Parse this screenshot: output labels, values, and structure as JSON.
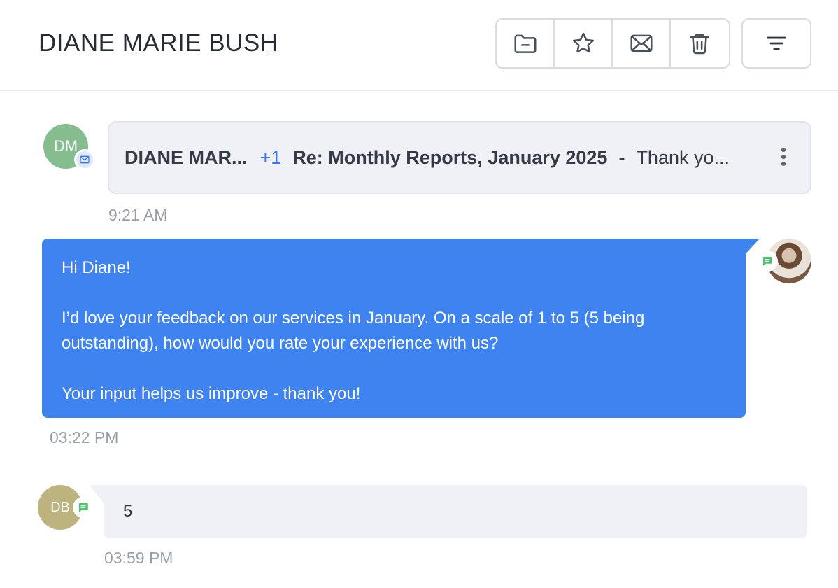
{
  "header": {
    "title": "DIANE MARIE BUSH",
    "actions": [
      {
        "icon": "folder-icon"
      },
      {
        "icon": "star-icon"
      },
      {
        "icon": "mail-icon"
      },
      {
        "icon": "trash-icon"
      }
    ],
    "filter_icon": "filter-icon"
  },
  "messages": {
    "email": {
      "avatar_initials": "DM",
      "avatar_color": "#86bd8f",
      "channel_icon": "mail-icon",
      "sender": "DIANE MAR...",
      "extra_recipients": "+1",
      "subject": "Re: Monthly Reports, January 2025",
      "separator": "-",
      "preview": "Thank yo...",
      "time": "9:21 AM"
    },
    "outgoing": {
      "channel_icon": "chat-icon",
      "line1": "Hi Diane!",
      "line2": "I’d love your feedback on our services in January. On a scale of 1 to 5 (5 being outstanding), how would you rate your experience with us?",
      "line3": "Your input helps us improve - thank you!",
      "time": "03:22 PM"
    },
    "incoming": {
      "avatar_initials": "DB",
      "avatar_color": "#bdb37e",
      "channel_icon": "chat-icon",
      "text": "5",
      "time": "03:59 PM"
    }
  },
  "colors": {
    "accent": "#3f83f0",
    "chat_badge": "#4fc06d",
    "mail_badge_bg": "#dfe8fb"
  }
}
